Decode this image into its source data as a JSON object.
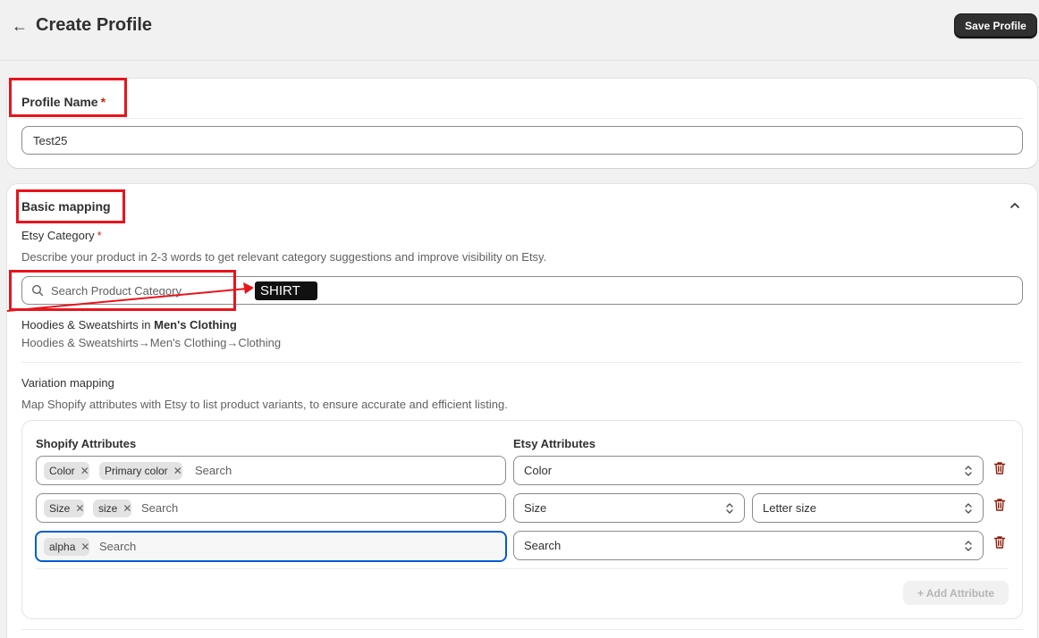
{
  "header": {
    "back_icon": "arrow-left-icon",
    "title": "Create Profile",
    "save_label": "Save Profile"
  },
  "profile": {
    "label": "Profile Name",
    "required": "*",
    "value": "Test25"
  },
  "basic_mapping": {
    "title": "Basic mapping",
    "category_label": "Etsy Category",
    "required": "*",
    "category_help": "Describe your product in 2-3 words to get relevant category suggestions and improve visibility on Etsy.",
    "search_placeholder": "Search Product Category",
    "annotation_tag": "SHIRT",
    "selected_prefix": "Hoodies & Sweatshirts in ",
    "selected_bold": "Men's Clothing",
    "selected_path": "Hoodies & Sweatshirts→Men's Clothing→Clothing"
  },
  "variation": {
    "title": "Variation mapping",
    "help": "Map Shopify attributes with Etsy to list product variants, to ensure accurate and efficient listing.",
    "shopify_header": "Shopify Attributes",
    "etsy_header": "Etsy Attributes",
    "search_placeholder": "Search",
    "rows": [
      {
        "chips": [
          "Color",
          "Primary color"
        ],
        "etsy": "Color",
        "etsy_secondary": ""
      },
      {
        "chips": [
          "Size",
          "size"
        ],
        "etsy": "Size",
        "etsy_secondary": "Letter size"
      },
      {
        "chips": [
          "alpha"
        ],
        "etsy": "Search",
        "etsy_secondary": ""
      }
    ],
    "add_label": "Add Attribute"
  },
  "colors": {
    "annotation_red": "#e8141c",
    "focus_blue": "#005bd3",
    "trash_red": "#8e1f0b"
  }
}
